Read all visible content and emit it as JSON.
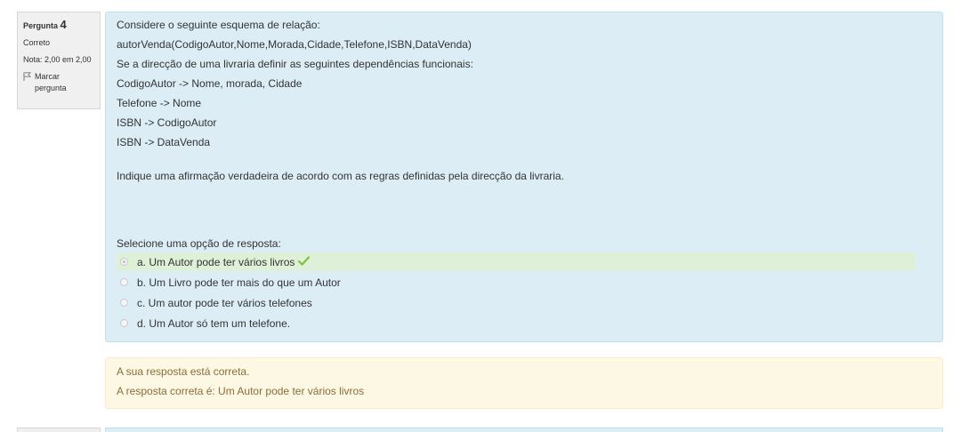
{
  "info": {
    "question_prefix": "Pergunta",
    "question_number": "4",
    "state": "Correto",
    "grade": "Nota: 2,00 em 2,00",
    "flag_label_1": "Marcar",
    "flag_label_2": "pergunta",
    "flag_icon": "flag-icon"
  },
  "question": {
    "lines": [
      "Considere o seguinte esquema de relação:",
      "autorVenda(CodigoAutor,Nome,Morada,Cidade,Telefone,ISBN,DataVenda)",
      "Se a direcção de uma livraria definir as seguintes dependências funcionais:",
      "CodigoAutor -> Nome, morada, Cidade",
      "Telefone -> Nome",
      "ISBN -> CodigoAutor",
      "ISBN -> DataVenda",
      "Indique uma afirmação verdadeira de acordo com as regras definidas pela direcção da livraria."
    ],
    "prompt": "Selecione uma opção de resposta:",
    "answers": [
      {
        "label": "a. Um Autor pode ter vários livros",
        "selected": true,
        "correct": true
      },
      {
        "label": "b. Um Livro pode ter mais do que um Autor",
        "selected": false,
        "correct": false
      },
      {
        "label": "c. Um autor pode ter vários telefones",
        "selected": false,
        "correct": false
      },
      {
        "label": "d. Um Autor só tem um telefone.",
        "selected": false,
        "correct": false
      }
    ],
    "check_icon": "checkmark-icon"
  },
  "feedback": {
    "status": "A sua resposta está correta.",
    "correct_answer": "A resposta correta é: Um Autor pode ter vários livros"
  },
  "colors": {
    "question_bg": "#dcedf6",
    "correct_answer_bg": "#def0d8",
    "feedback_bg": "#fcf8e3",
    "feedback_text": "#8a6d3b",
    "check": "#7cc142"
  }
}
